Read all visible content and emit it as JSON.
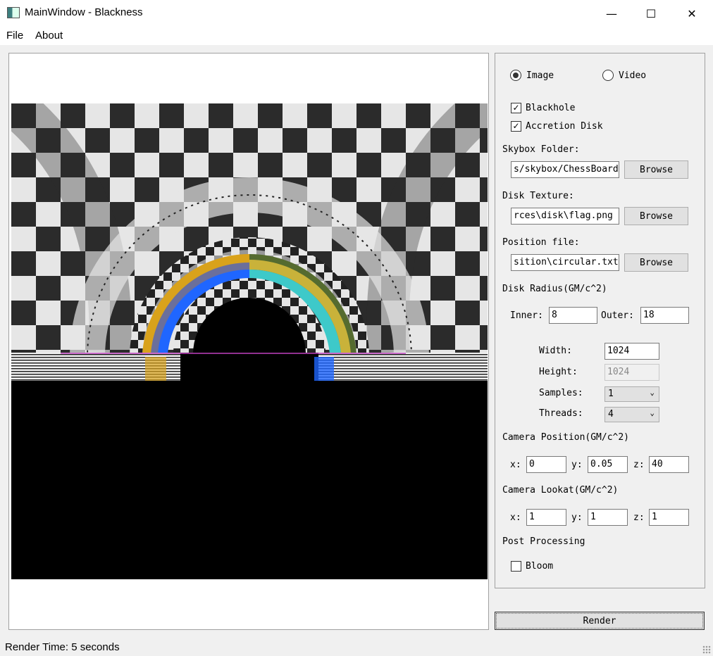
{
  "window": {
    "title": "MainWindow - Blackness",
    "minimize": "—",
    "maximize": "☐",
    "close": "✕"
  },
  "menu": {
    "items": [
      "File",
      "About"
    ]
  },
  "mode": {
    "image_label": "Image",
    "video_label": "Video",
    "selected": "Image"
  },
  "options": {
    "blackhole_label": "Blackhole",
    "blackhole_checked": true,
    "disk_label": "Accretion Disk",
    "disk_checked": true
  },
  "skybox": {
    "label": "Skybox Folder:",
    "value": "s/skybox/ChessBoard",
    "browse": "Browse"
  },
  "disk_texture": {
    "label": "Disk Texture:",
    "value": "rces\\disk\\flag.png",
    "browse": "Browse"
  },
  "position_file": {
    "label": "Position file:",
    "value": "sition\\circular.txt",
    "browse": "Browse"
  },
  "disk_radius": {
    "label": "Disk Radius(GM/c^2)",
    "inner_label": "Inner:",
    "inner": "8",
    "outer_label": "Outer:",
    "outer": "18"
  },
  "output": {
    "width_label": "Width:",
    "width": "1024",
    "height_label": "Height:",
    "height": "1024",
    "samples_label": "Samples:",
    "samples": "1",
    "threads_label": "Threads:",
    "threads": "4"
  },
  "camera_position": {
    "label": "Camera Position(GM/c^2)",
    "x_label": "x:",
    "x": "0",
    "y_label": "y:",
    "y": "0.05",
    "z_label": "z:",
    "z": "40"
  },
  "camera_lookat": {
    "label": "Camera Lookat(GM/c^2)",
    "x_label": "x:",
    "x": "1",
    "y_label": "y:",
    "y": "1",
    "z_label": "z:",
    "z": "1"
  },
  "post": {
    "label": "Post Processing",
    "bloom_label": "Bloom",
    "bloom_checked": false
  },
  "render_button": "Render",
  "status": "Render Time: 5 seconds",
  "icons": {
    "chevron": "chevron-down-icon",
    "check": "check-icon"
  }
}
